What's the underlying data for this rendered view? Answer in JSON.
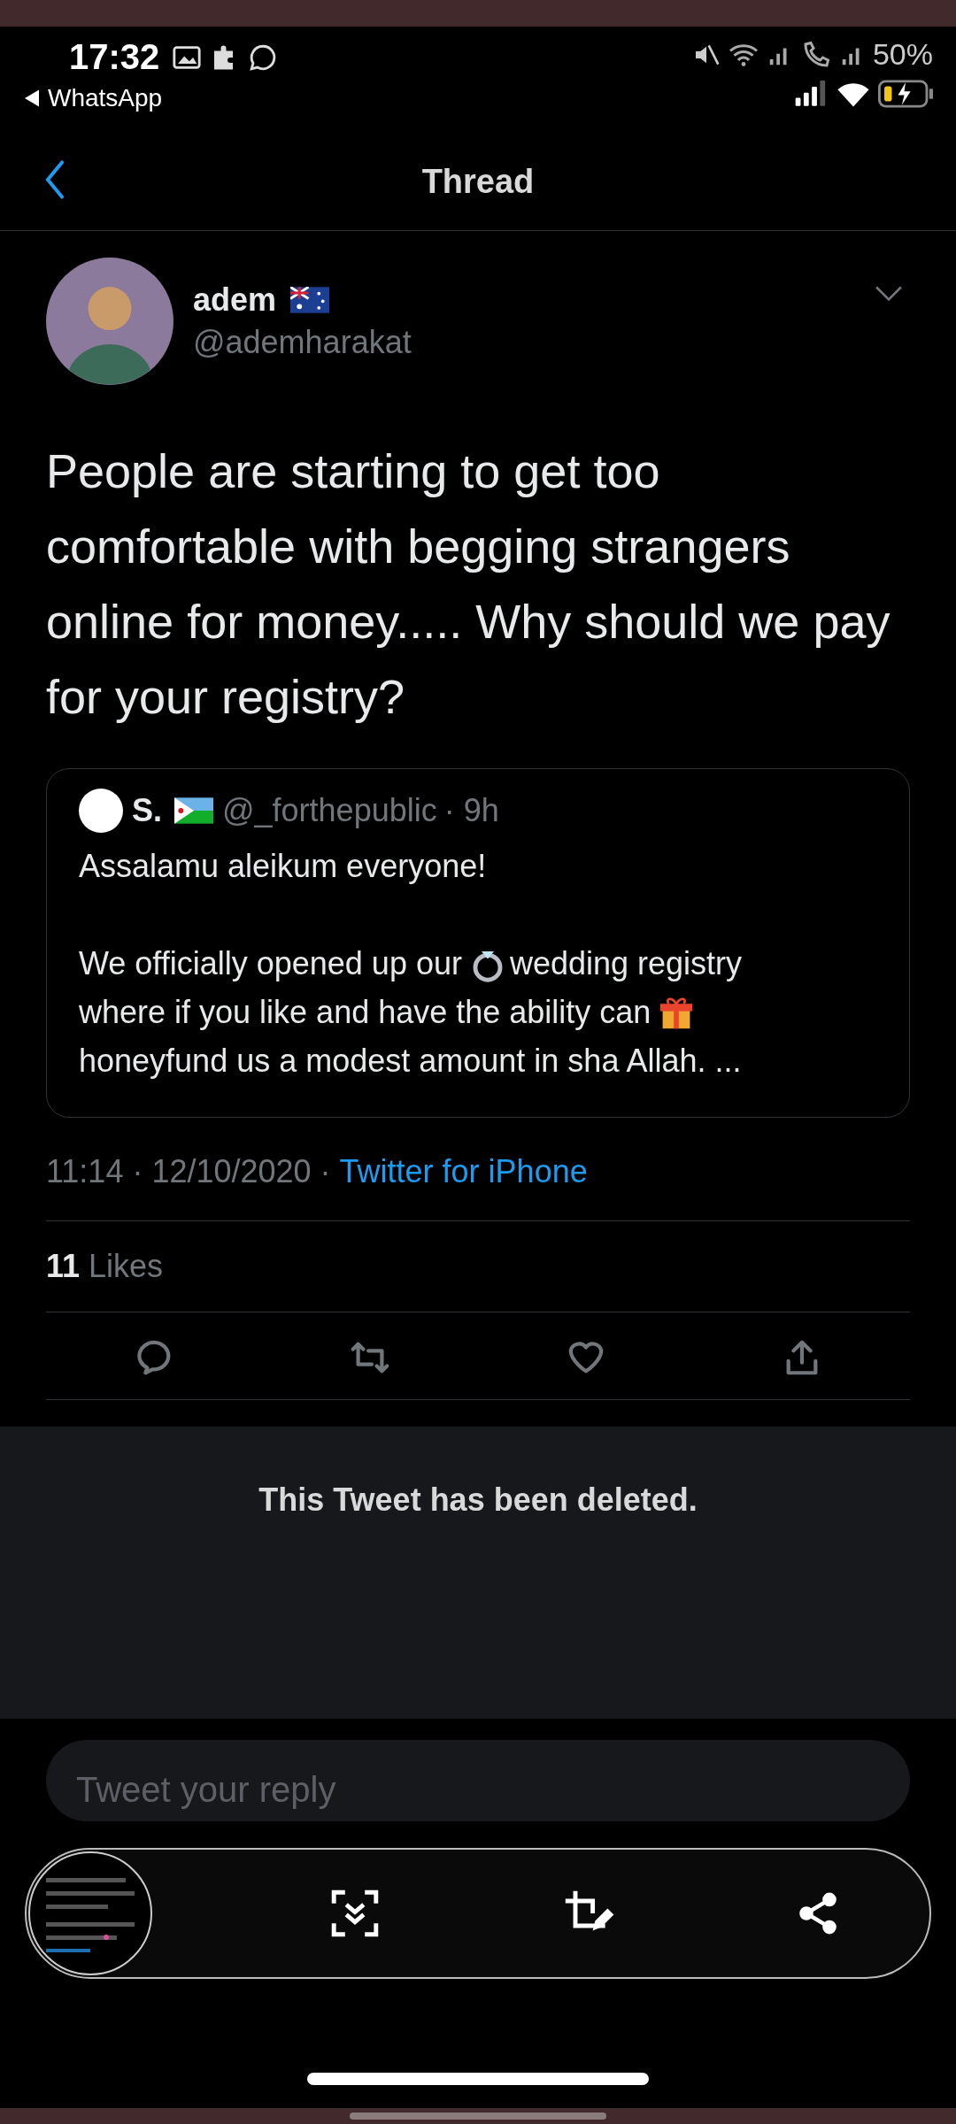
{
  "status_bar": {
    "time": "17:32",
    "app": "WhatsApp",
    "battery": "50%"
  },
  "header": {
    "title": "Thread"
  },
  "tweet": {
    "name": "adem",
    "handle": "@ademharakat",
    "text": "People are starting to get too comfortable with begging strangers online for money..... Why should we pay for your registry?",
    "quote": {
      "name": "S.",
      "handle": "@_forthepublic",
      "time": "· 9h",
      "greeting": "Assalamu aleikum everyone!",
      "parts": [
        "We officially opened up our",
        "wedding registry",
        "where if you like and have the ability can",
        "honeyfund us a modest amount in sha Allah. ..."
      ]
    },
    "timestamp": "11:14 · 12/10/2020 ·",
    "source": "Twitter for iPhone",
    "likes_count": "11",
    "likes_label": "Likes"
  },
  "deleted_notice": "This Tweet has been deleted.",
  "reply": {
    "placeholder": "Tweet your reply"
  }
}
